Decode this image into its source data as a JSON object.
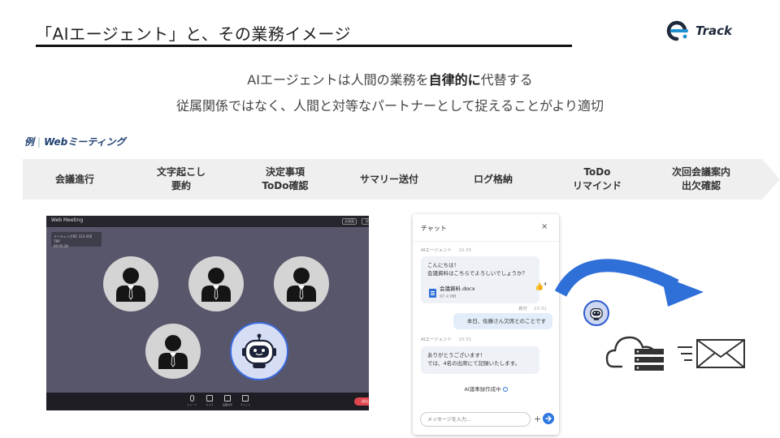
{
  "header": {
    "title": "「AIエージェント」と、その業務イメージ",
    "logo_text": "Track"
  },
  "subtitle": {
    "line1_pre": "AIエージェントは人間の業務を",
    "line1_bold": "自律的に",
    "line1_post": "代替する",
    "line2": "従属関係ではなく、人間と対等なパートナーとして捉えることがより適切"
  },
  "example": {
    "prefix": "例",
    "label": "Webミーティング"
  },
  "steps": [
    {
      "line1": "会議進行",
      "line2": ""
    },
    {
      "line1": "文字起こし",
      "line2": "要約"
    },
    {
      "line1": "決定事項",
      "line2": "ToDo確認"
    },
    {
      "line1": "サマリー送付",
      "line2": ""
    },
    {
      "line1": "ログ格納",
      "line2": ""
    },
    {
      "line1": "ToDo",
      "line2": "リマインド"
    },
    {
      "line1": "次回会議案内",
      "line2": "出欠確認"
    }
  ],
  "meeting": {
    "title": "Web Meeting",
    "top_buttons": [
      "全画面",
      "設定"
    ],
    "info_line1": "ミーティングID: 123 456 789",
    "info_line2": "00:05:28",
    "controls": [
      "ミュート",
      "カメラ",
      "画面共有",
      "チャット"
    ],
    "leave_label": "退出"
  },
  "chat": {
    "title": "チャット",
    "close_icon": "×",
    "messages": [
      {
        "sender": "AIエージェント",
        "time": "10:30",
        "line1": "こんにちは！",
        "line2": "会議資料はこちらでよろしいでしょうか？"
      },
      {
        "sender": "自分",
        "time": "10:31",
        "line1": "本日、佐藤さん欠席とのことです",
        "line2": ""
      },
      {
        "sender": "AIエージェント",
        "time": "10:31",
        "line1": "ありがとうございます！",
        "line2": "では、4名の出席にて記録いたします。"
      }
    ],
    "file": {
      "name": "会議資料.docx",
      "size": "97.4 MB"
    },
    "reaction": {
      "emoji": "👍",
      "count": "4"
    },
    "status": "AI議事録作成中",
    "input_placeholder": "メッセージを入力...",
    "plus_label": "+"
  },
  "colors": {
    "accent": "#2f77e0",
    "brand_dark": "#1e3f70",
    "meeting_bg": "#58566a",
    "leave_red": "#e0474c"
  }
}
